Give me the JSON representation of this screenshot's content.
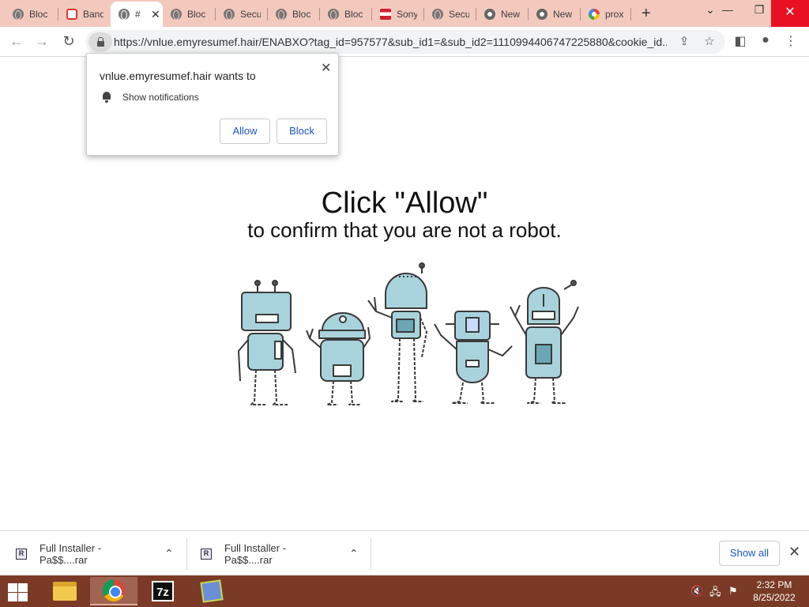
{
  "tabs": [
    {
      "title": "Bloc",
      "icon": "globe-icon"
    },
    {
      "title": "Band",
      "icon": "bandcamp-icon"
    },
    {
      "title": "#",
      "icon": "globe-icon",
      "active": true
    },
    {
      "title": "Bloc",
      "icon": "globe-icon"
    },
    {
      "title": "Secu",
      "icon": "globe-icon"
    },
    {
      "title": "Bloc",
      "icon": "globe-icon"
    },
    {
      "title": "Bloc",
      "icon": "globe-icon"
    },
    {
      "title": "Sony",
      "icon": "sony-flag-icon"
    },
    {
      "title": "Secu",
      "icon": "globe-icon"
    },
    {
      "title": "New",
      "icon": "chrome-icon"
    },
    {
      "title": "New",
      "icon": "chrome-icon"
    },
    {
      "title": "prox",
      "icon": "google-icon"
    }
  ],
  "address_bar": {
    "url": "https://vnlue.emyresumef.hair/ENABXO?tag_id=957577&sub_id1=&sub_id2=1110994406747225880&cookie_id..."
  },
  "permission_popup": {
    "site": "vnlue.emyresumef.hair wants to",
    "permission": "Show notifications",
    "allow_label": "Allow",
    "block_label": "Block"
  },
  "page": {
    "headline": "Click \"Allow\"",
    "subline": "to confirm that you are not a robot."
  },
  "downloads": [
    {
      "name": "Full Installer - Pa$$....rar",
      "icon_label": "R"
    },
    {
      "name": "Full Installer - Pa$$....rar",
      "icon_label": "R"
    }
  ],
  "download_shelf": {
    "show_all_label": "Show all"
  },
  "taskbar": {
    "time": "2:32 PM",
    "date": "8/25/2022",
    "apps": [
      "file-explorer-icon",
      "chrome-icon",
      "7zip-icon",
      "installer-icon"
    ]
  },
  "colors": {
    "tabstrip": "#f4c9bd",
    "taskbar": "#7a3a26",
    "link_blue": "#1a56c4",
    "robot_body": "#a9d3dc"
  }
}
